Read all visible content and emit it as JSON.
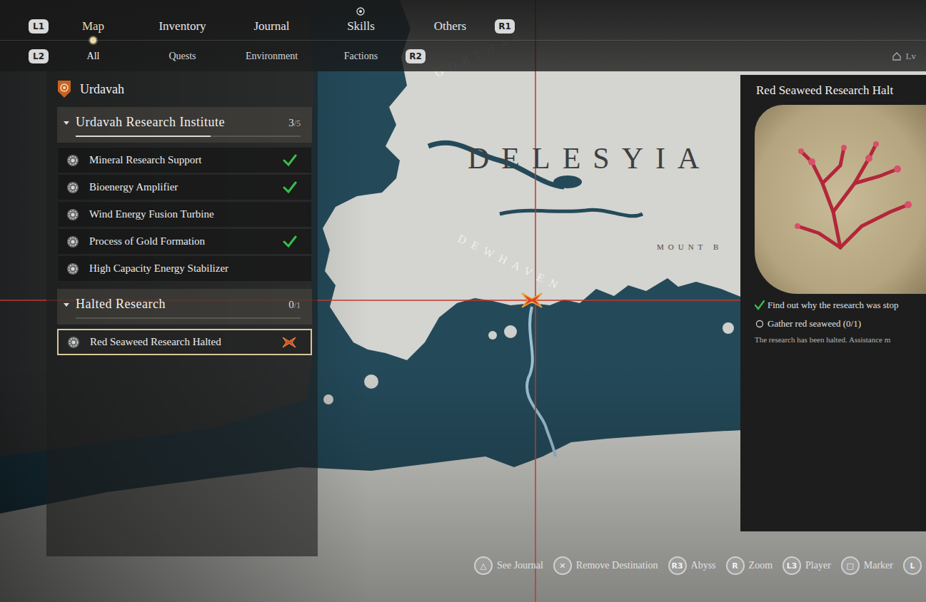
{
  "nav": {
    "left_key": "L1",
    "right_key": "R1",
    "tabs": [
      {
        "label": "Map",
        "selected": true,
        "kind": "plain"
      },
      {
        "label": "Inventory",
        "selected": false,
        "kind": "plain"
      },
      {
        "label": "Journal",
        "selected": false,
        "kind": "plain"
      },
      {
        "label": "Skills",
        "selected": false,
        "kind": "alert"
      },
      {
        "label": "Others",
        "selected": false,
        "kind": "plain"
      }
    ]
  },
  "subnav": {
    "left_key": "L2",
    "right_key": "R2",
    "tabs": [
      {
        "label": "All",
        "selected": true
      },
      {
        "label": "Quests",
        "selected": false
      },
      {
        "label": "Environment",
        "selected": false
      },
      {
        "label": "Factions",
        "selected": false
      }
    ]
  },
  "level_badge": "Lv",
  "sidebar": {
    "region": "Urdavah",
    "groups": [
      {
        "title": "Urdavah Research Institute",
        "count": "3",
        "total": "/5",
        "level": 0.6,
        "expanded": true,
        "quests": [
          {
            "name": "Mineral Research Support",
            "completed": true,
            "selected": false,
            "tracked": false
          },
          {
            "name": "Bioenergy Amplifier",
            "completed": true,
            "selected": false,
            "tracked": false
          },
          {
            "name": "Wind Energy Fusion Turbine",
            "completed": false,
            "selected": false,
            "tracked": false
          },
          {
            "name": "Process of Gold Formation",
            "completed": true,
            "selected": false,
            "tracked": false
          },
          {
            "name": "High Capacity Energy Stabilizer",
            "completed": false,
            "selected": false,
            "tracked": false
          }
        ]
      },
      {
        "title": "Halted Research",
        "count": "0",
        "total": "/1",
        "level": 0,
        "expanded": true,
        "quests": [
          {
            "name": "Red Seaweed Research Halted",
            "completed": false,
            "selected": true,
            "tracked": true
          }
        ]
      }
    ]
  },
  "map": {
    "labels": [
      {
        "text": "GORTHAK",
        "kind": "region"
      },
      {
        "text": "DELESYIA",
        "kind": "kingdom"
      },
      {
        "text": "DEWHAVEN",
        "kind": "region"
      },
      {
        "text": "MOUNT B",
        "kind": "area"
      }
    ]
  },
  "detail": {
    "title": "Red Seaweed Research Halt",
    "objectives": [
      {
        "text": "Find out why the research was stop",
        "done": true
      },
      {
        "text": "Gather red seaweed (0/1)",
        "done": false
      }
    ],
    "description": "The research has been halted. Assistance m"
  },
  "hints": [
    {
      "key": "△",
      "label": "See Journal"
    },
    {
      "key": "✕",
      "label": "Remove Destination"
    },
    {
      "key": "R3",
      "label": "Abyss"
    },
    {
      "key": "R",
      "label": "Zoom"
    },
    {
      "key": "L3",
      "label": "Player"
    },
    {
      "key": "□",
      "label": "Marker"
    },
    {
      "key": "L",
      "label": ""
    }
  ]
}
